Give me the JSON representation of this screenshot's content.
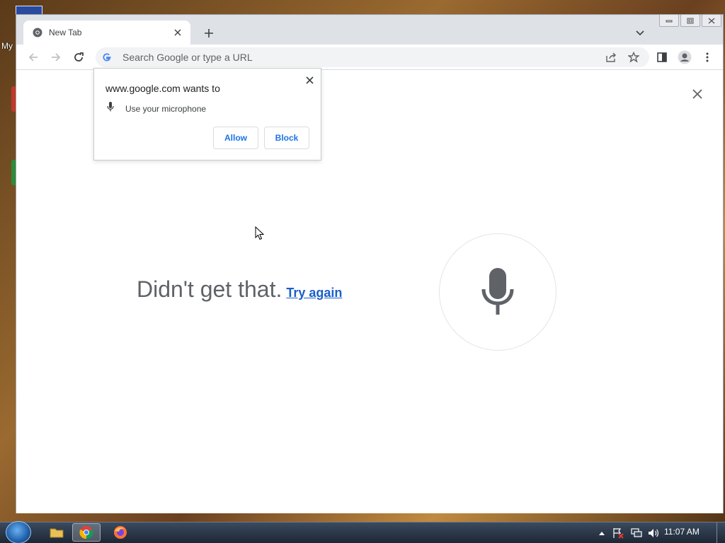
{
  "browser": {
    "tab": {
      "title": "New Tab"
    },
    "omnibox": {
      "placeholder": "Search Google or type a URL"
    }
  },
  "popup": {
    "title": "www.google.com wants to",
    "permission": "Use your microphone",
    "allow_label": "Allow",
    "block_label": "Block"
  },
  "page": {
    "message": "Didn't get that.",
    "retry_link": "Try again"
  },
  "desktop": {
    "icon_label": "My"
  },
  "taskbar": {
    "clock": "11:07 AM",
    "apps": [
      "file-explorer-icon",
      "chrome-icon",
      "firefox-icon"
    ]
  },
  "colors": {
    "link": "#1a5fc7",
    "button_text": "#1a73e8",
    "mic": "#5f6368"
  }
}
